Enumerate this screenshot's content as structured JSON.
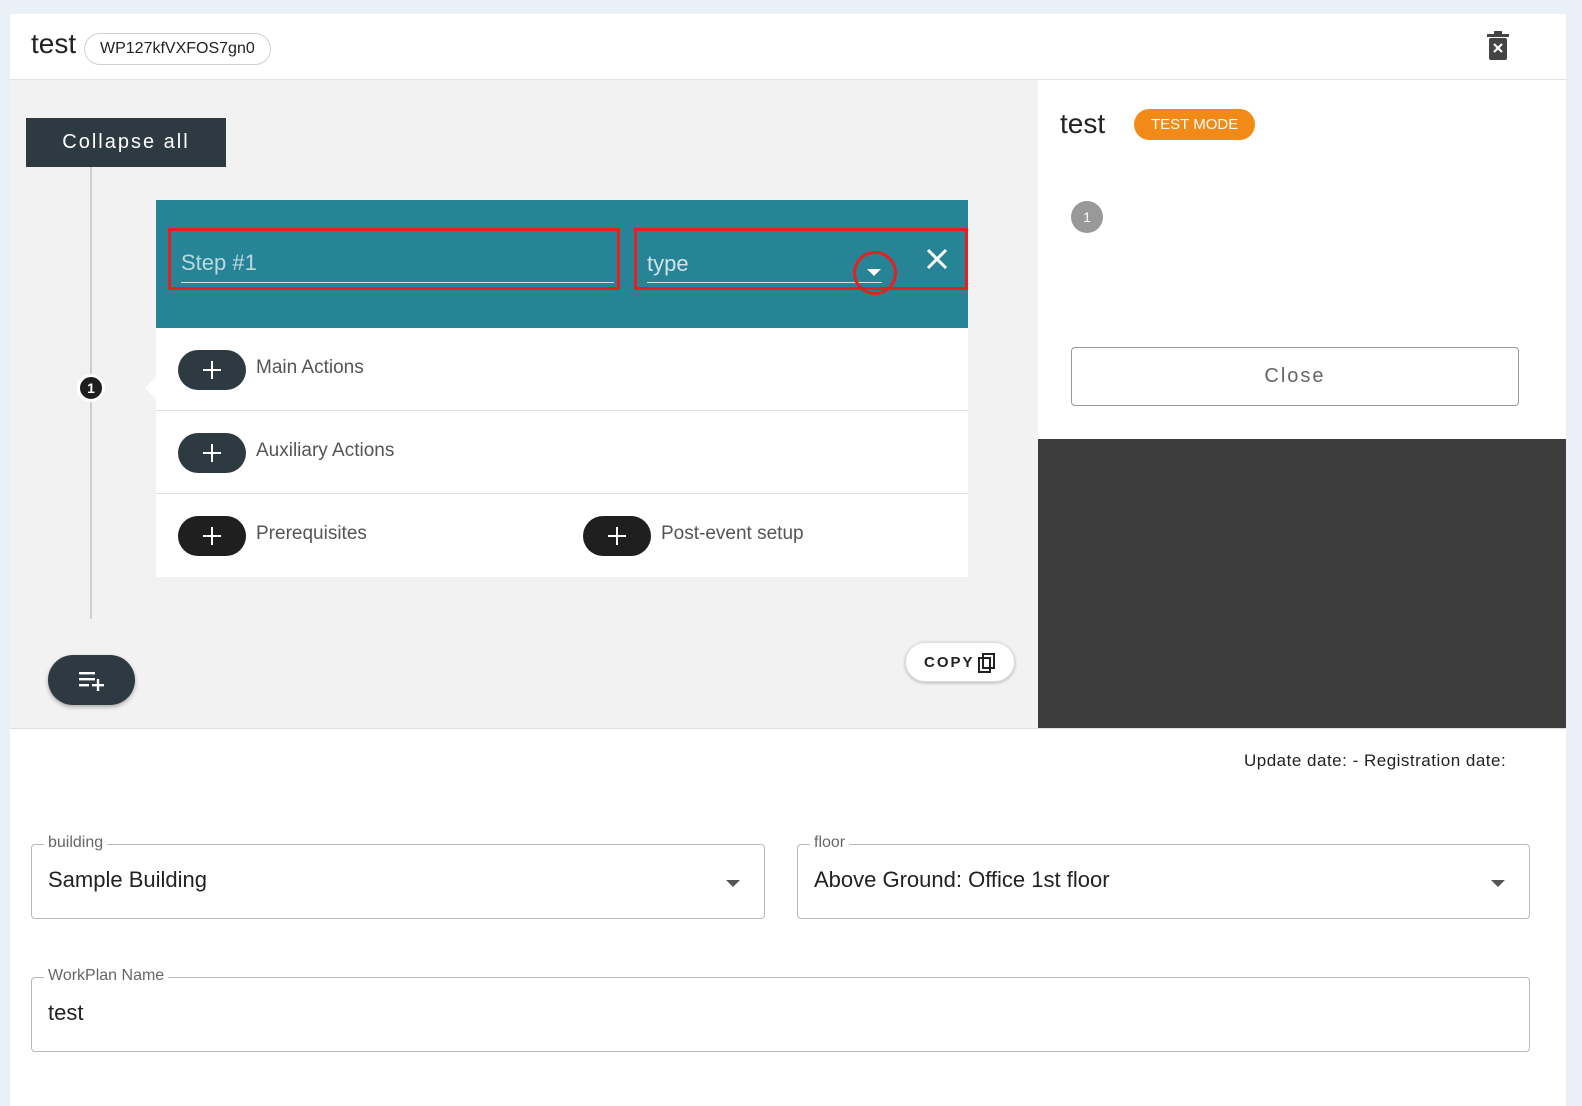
{
  "header": {
    "title": "test",
    "id_chip": "WP127kfVXFOS7gn0"
  },
  "left_panel": {
    "collapse_label": "Collapse all",
    "step_number": "1",
    "step": {
      "name_placeholder": "Step #1",
      "type_placeholder": "type"
    },
    "actions": {
      "main": "Main Actions",
      "auxiliary": "Auxiliary Actions",
      "prerequisites": "Prerequisites",
      "post_event": "Post-event setup"
    },
    "copy_label": "COPY"
  },
  "right_panel": {
    "title": "test",
    "badge": "TEST MODE",
    "step_number": "1",
    "close_label": "Close"
  },
  "footer": {
    "dates": "Update date: - Registration date:",
    "building": {
      "label": "building",
      "value": "Sample Building"
    },
    "floor": {
      "label": "floor",
      "value": "Above Ground: Office 1st floor"
    },
    "workplan_name": {
      "label": "WorkPlan Name",
      "value": "test"
    }
  },
  "colors": {
    "step_header": "#268496",
    "highlight": "#e62020",
    "badge": "#f28a18",
    "dark_button": "#2e3a42"
  },
  "icons": [
    "trash-icon",
    "close-icon",
    "chevron-down-icon",
    "plus-icon",
    "add-list-icon",
    "clipboard-icon"
  ]
}
